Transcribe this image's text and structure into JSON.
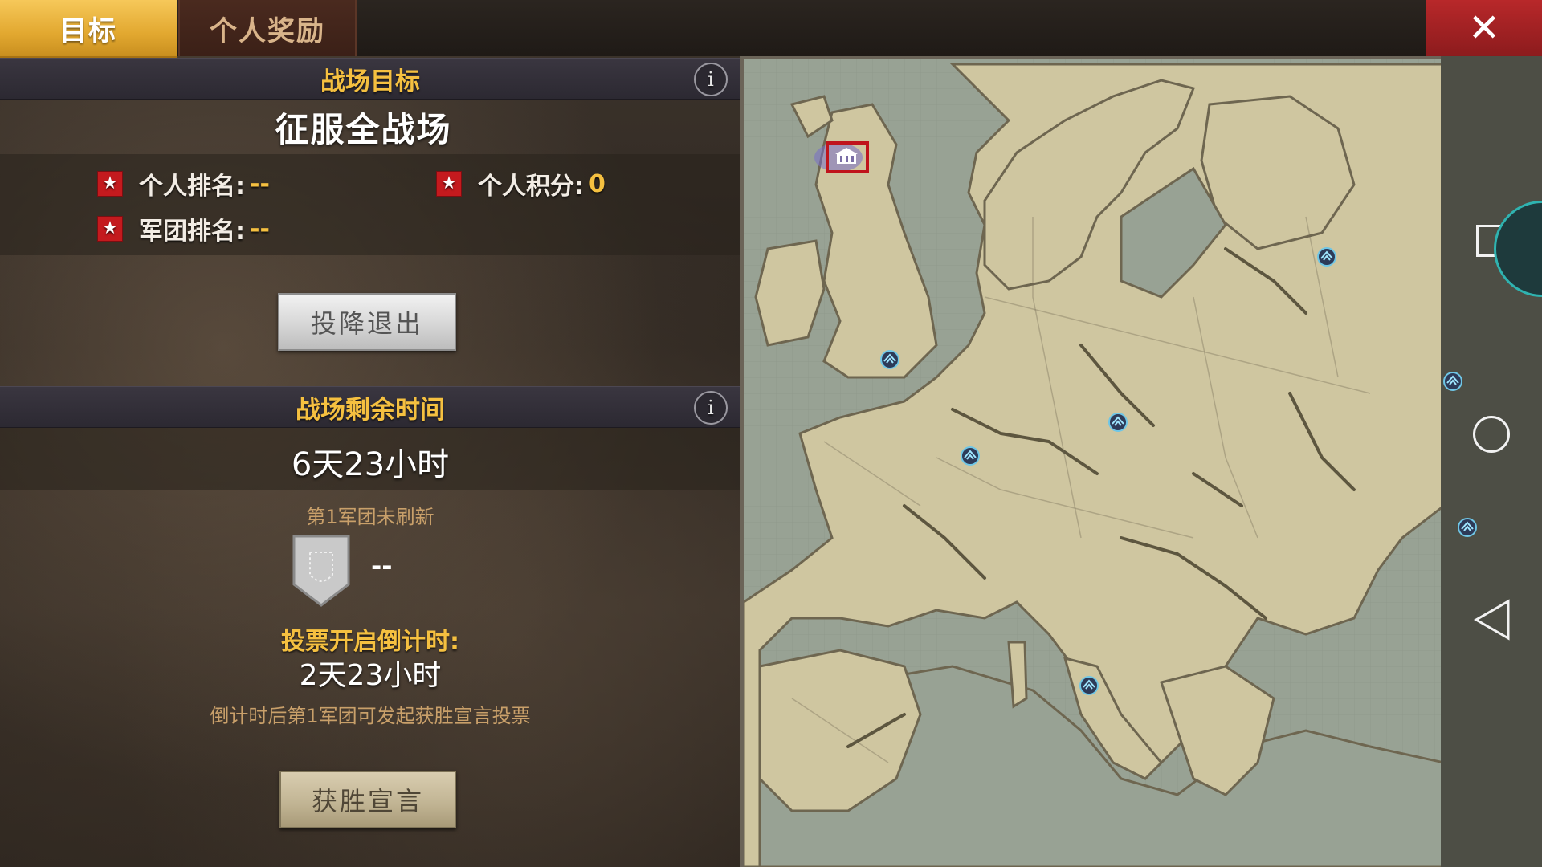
{
  "tabs": {
    "objective": "目标",
    "personal_rewards": "个人奖励"
  },
  "close_label": "✕",
  "battle_objective": {
    "header": "战场目标",
    "info": "i",
    "title": "征服全战场",
    "personal_rank_label": "个人排名:",
    "personal_rank_value": "--",
    "personal_score_label": "个人积分:",
    "personal_score_value": "0",
    "legion_rank_label": "军团排名:",
    "legion_rank_value": "--",
    "surrender_button": "投降退出"
  },
  "remaining_time": {
    "header": "战场剩余时间",
    "info": "i",
    "value": "6天23小时",
    "legion_status": "第1军团未刷新",
    "legion_value": "--",
    "vote_countdown_label": "投票开启倒计时:",
    "vote_countdown_value": "2天23小时",
    "vote_note": "倒计时后第1军团可发起获胜宣言投票",
    "victory_button": "获胜宣言"
  },
  "map": {
    "markers": [
      "eagle-marker",
      "eagle-marker",
      "eagle-marker",
      "eagle-marker",
      "eagle-marker",
      "eagle-marker",
      "eagle-marker",
      "eagle-marker"
    ],
    "capital_marker": "capital-building-icon",
    "colors": {
      "land": "#cfc6a0",
      "sea": "#98a294",
      "ridge": "#5d563f",
      "selection": "#c0141c"
    }
  },
  "system_nav": {
    "icons": [
      "recent-apps-icon",
      "home-icon",
      "back-icon"
    ]
  }
}
